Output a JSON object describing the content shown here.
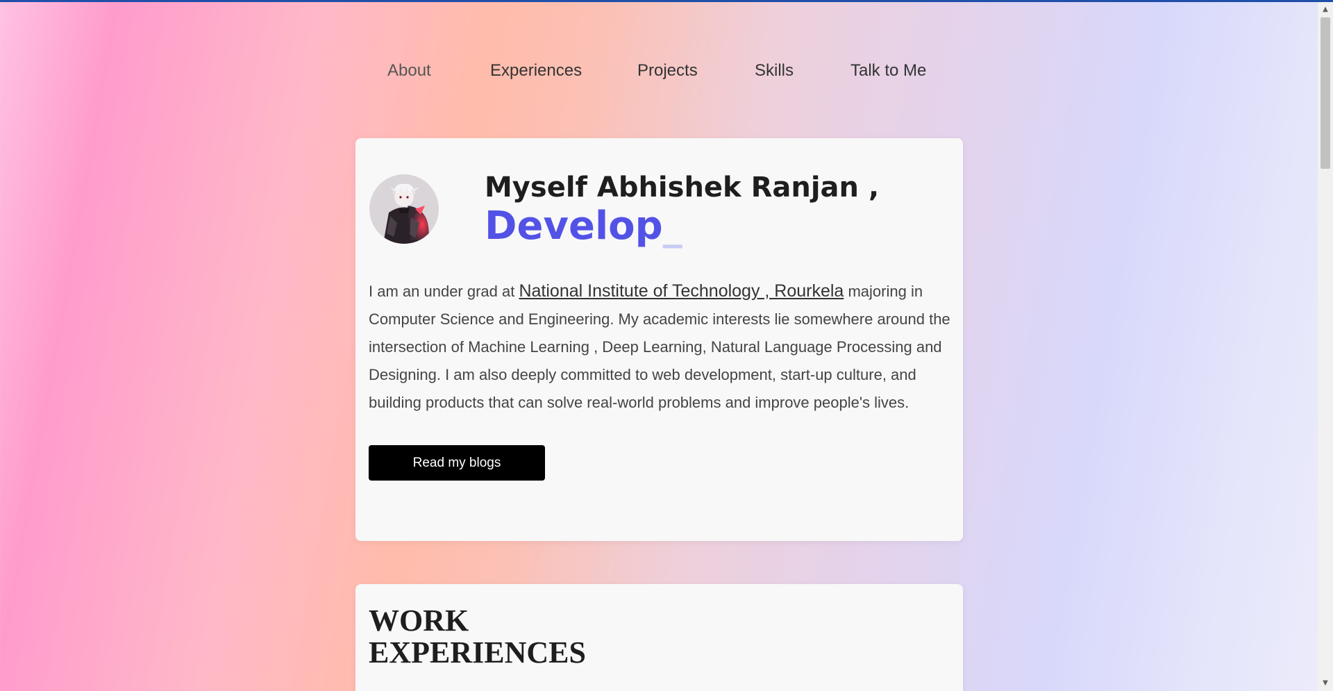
{
  "nav": {
    "items": [
      {
        "label": "About"
      },
      {
        "label": "Experiences"
      },
      {
        "label": "Projects"
      },
      {
        "label": "Skills"
      },
      {
        "label": "Talk to Me"
      }
    ]
  },
  "hero": {
    "heading": "Myself Abhishek Ranjan ,",
    "typed_text": "Develop",
    "cursor": "_",
    "bio": {
      "prefix": "I am an under grad at ",
      "link_text": "National Institute of Technology , Rourkela",
      "suffix": " majoring in Computer Science and Engineering. My academic interests lie somewhere around the intersection of Machine Learning , Deep Learning, Natural Language Processing and Designing. I am also deeply committed to web development, start-up culture, and building products that can solve real-world problems and improve people's lives."
    },
    "button_label": "Read my blogs"
  },
  "work": {
    "title": "WORK EXPERIENCES"
  },
  "colors": {
    "accent": "#5352e6",
    "cursor": "#c9cbf4",
    "button_bg": "#000000",
    "card_bg": "#f8f8f8",
    "top_bar": "#1f4fa8"
  },
  "icons": {
    "avatar": "anime-avatar-image",
    "scroll_up": "chevron-up-icon",
    "scroll_down": "chevron-down-icon"
  }
}
